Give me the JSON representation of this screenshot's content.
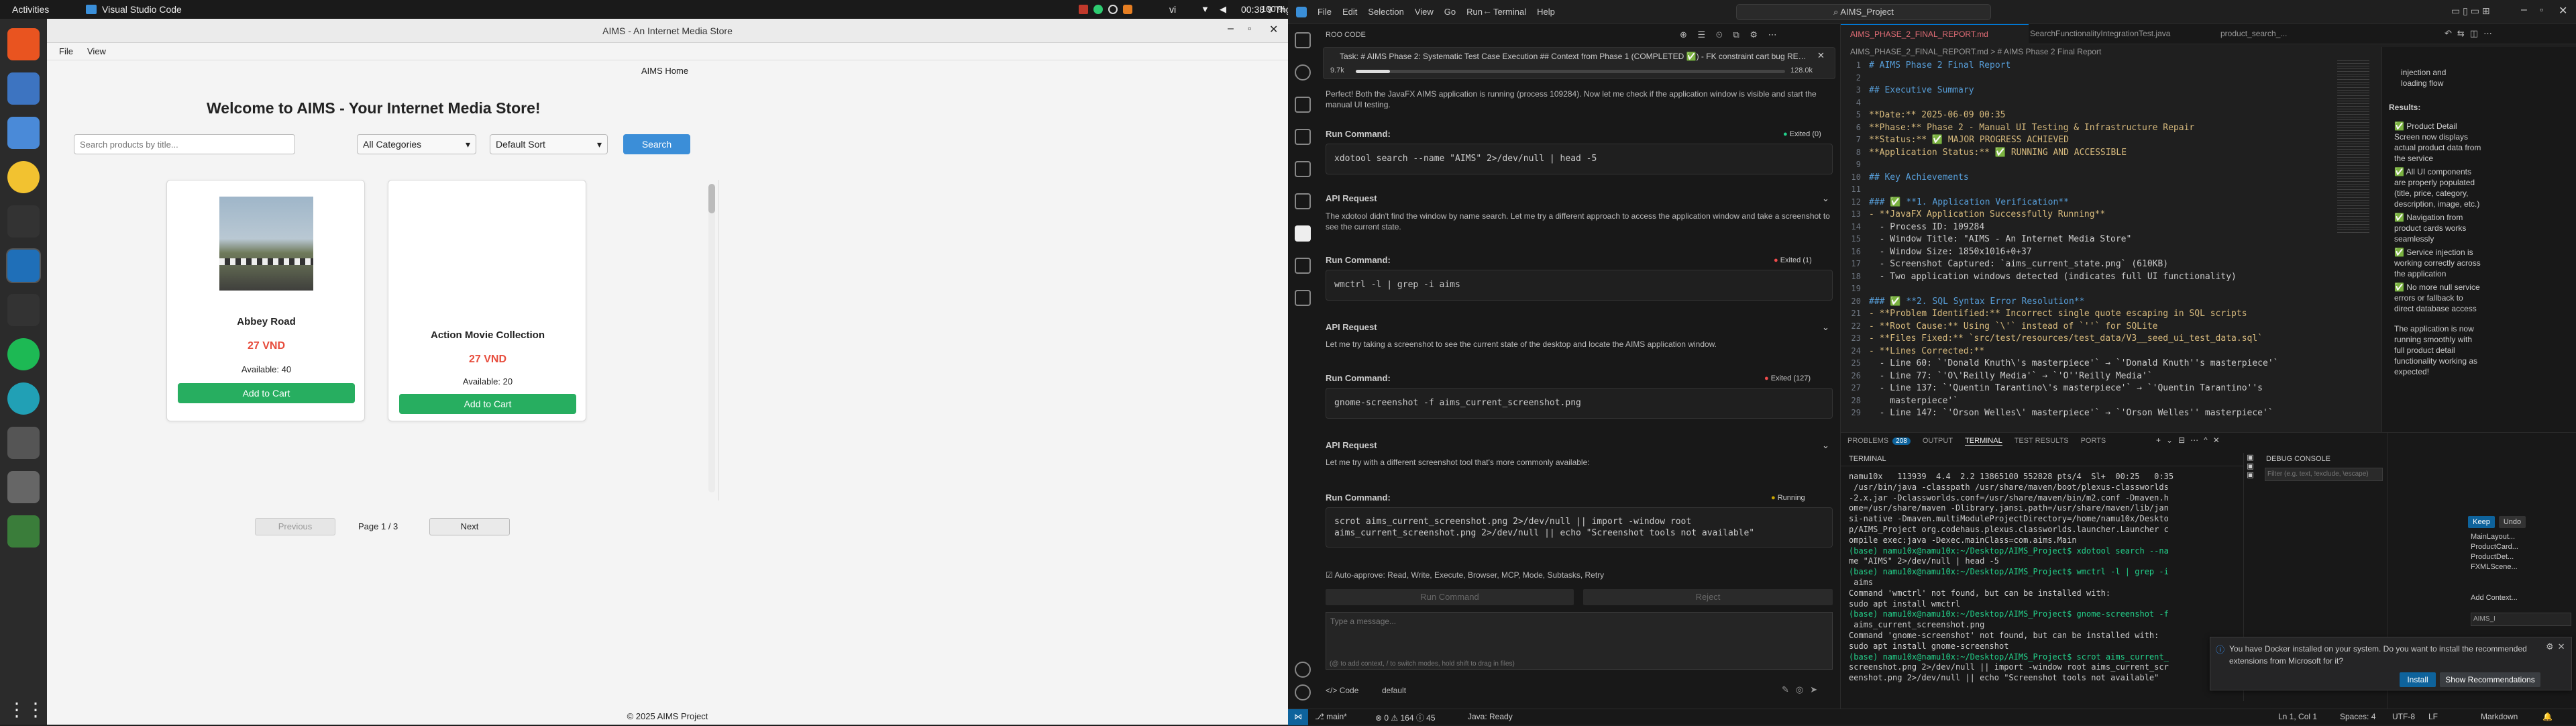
{
  "topbar": {
    "activities": "Activities",
    "app": "Visual Studio Code",
    "clock": "00:38 9 Thg 6",
    "lang": "vi",
    "battery": "100 %"
  },
  "fx": {
    "title": "AIMS - An Internet Media Store",
    "menu": {
      "file": "File",
      "view": "View"
    },
    "breadcrumb": "AIMS Home",
    "welcome": "Welcome to AIMS - Your Internet Media Store!",
    "search_placeholder": "Search products by title...",
    "category": "All Categories",
    "sort": "Default Sort",
    "search_btn": "Search",
    "products": [
      {
        "title": "Abbey Road",
        "price": "27 VND",
        "stock": "Available: 40",
        "btn": "Add to Cart"
      },
      {
        "title": "Action Movie Collection",
        "price": "27 VND",
        "stock": "Available: 20",
        "btn": "Add to Cart"
      }
    ],
    "pager": {
      "prev": "Previous",
      "page": "Page 1 / 3",
      "next": "Next"
    },
    "footer": "© 2025 AIMS Project"
  },
  "vs": {
    "menu": [
      "File",
      "Edit",
      "Selection",
      "View",
      "Go",
      "Run",
      "Terminal",
      "Help"
    ],
    "search": "AIMS_Project",
    "roo": {
      "header": "ROO CODE",
      "task": "Task: # AIMS Phase 2: Systematic Test Case Execution ## Context from Phase 1 (COMPLETED ✅) - FK constraint cart bug RESOL...",
      "tokens": "9.7k",
      "ctx": "128.0k",
      "intro": "Perfect! Both the JavaFX AIMS application is running (process 109284). Now let me check if the application window is visible and start the manual UI testing.",
      "blocks": [
        {
          "label": "Run Command:",
          "status": "Exited (0)",
          "cmd": "xdotool search --name \"AIMS\" 2>/dev/null | head -5"
        },
        {
          "label": "API Request",
          "text": "The xdotool didn't find the window by name search. Let me try a different approach to access the application window and take a screenshot to see the current state."
        },
        {
          "label": "Run Command:",
          "status": "Exited (1)",
          "cmd": "wmctrl -l | grep -i aims"
        },
        {
          "label": "API Request",
          "text": "Let me try taking a screenshot to see the current state of the desktop and locate the AIMS application window."
        },
        {
          "label": "Run Command:",
          "status": "Exited (127)",
          "cmd": "gnome-screenshot -f aims_current_screenshot.png"
        },
        {
          "label": "API Request",
          "text": "Let me try with a different screenshot tool that's more commonly available:"
        },
        {
          "label": "Run Command:",
          "status": "Running",
          "cmd": "scrot aims_current_screenshot.png 2>/dev/null || import -window root aims_current_screenshot.png 2>/dev/null || echo \"Screenshot tools not available\""
        }
      ],
      "auto": "Auto-approve: Read, Write, Execute, Browser, MCP, Mode, Subtasks, Retry",
      "runcmd": "Run Command",
      "reject": "Reject",
      "placeholder": "Type a message...",
      "hint": "(@ to add context, / to switch modes, hold shift to drag in files)",
      "mode": "Code",
      "profile": "default"
    },
    "tabs": [
      "AIMS_PHASE_2_FINAL_REPORT.md",
      "SearchFunctionalityIntegrationTest.java",
      "product_search_..."
    ],
    "breadcrumb": "AIMS_PHASE_2_FINAL_REPORT.md > # AIMS Phase 2 Final Report",
    "md": [
      "# AIMS Phase 2 Final Report",
      "",
      "## Executive Summary",
      "",
      "**Date:** 2025-06-09 00:35",
      "**Phase:** Phase 2 - Manual UI Testing & Infrastructure Repair",
      "**Status:** ✅ MAJOR PROGRESS ACHIEVED",
      "**Application Status:** ✅ RUNNING AND ACCESSIBLE",
      "",
      "## Key Achievements",
      "",
      "### ✅ **1. Application Verification**",
      "- **JavaFX Application Successfully Running**",
      "  - Process ID: 109284",
      "  - Window Title: \"AIMS - An Internet Media Store\"",
      "  - Window Size: 1850x1016+0+37",
      "  - Screenshot Captured: `aims_current_state.png` (610KB)",
      "  - Two application windows detected (indicates full UI functionality)",
      "",
      "### ✅ **2. SQL Syntax Error Resolution**",
      "- **Problem Identified:** Incorrect single quote escaping in SQL scripts",
      "- **Root Cause:** Using `\\'` instead of `''` for SQLite",
      "- **Files Fixed:** `src/test/resources/test_data/V3__seed_ui_test_data.sql`",
      "- **Lines Corrected:**",
      "  - Line 60: `'Donald Knuth\\'s masterpiece'` → `'Donald Knuth''s masterpiece'`",
      "  - Line 77: `'O\\'Reilly Media'` → `'O''Reilly Media'`",
      "  - Line 137: `'Quentin Tarantino\\'s masterpiece'` → `'Quentin Tarantino''s",
      "    masterpiece'`",
      "  - Line 147: `'Orson Welles\\' masterpiece'` → `'Orson Welles'' masterpiece'`"
    ],
    "panel_tabs": [
      "PROBLEMS",
      "OUTPUT",
      "TERMINAL",
      "TEST RESULTS",
      "PORTS"
    ],
    "problems_count": "208",
    "terminal": [
      "namu10x   113939  4.4  2.2 13865100 552828 pts/4  Sl+  00:25   0:35",
      " /usr/bin/java -classpath /usr/share/maven/boot/plexus-classworlds",
      "-2.x.jar -Dclassworlds.conf=/usr/share/maven/bin/m2.conf -Dmaven.h",
      "ome=/usr/share/maven -Dlibrary.jansi.path=/usr/share/maven/lib/jan",
      "si-native -Dmaven.multiModuleProjectDirectory=/home/namu10x/Deskto",
      "p/AIMS_Project org.codehaus.plexus.classworlds.launcher.Launcher c",
      "ompile exec:java -Dexec.mainClass=com.aims.Main",
      "(base) namu10x@namu10x:~/Desktop/AIMS_Project$ xdotool search --na",
      "me \"AIMS\" 2>/dev/null | head -5",
      "(base) namu10x@namu10x:~/Desktop/AIMS_Project$ wmctrl -l | grep -i",
      " aims",
      "Command 'wmctrl' not found, but can be installed with:",
      "sudo apt install wmctrl",
      "(base) namu10x@namu10x:~/Desktop/AIMS_Project$ gnome-screenshot -f",
      " aims_current_screenshot.png",
      "Command 'gnome-screenshot' not found, but can be installed with:",
      "sudo apt install gnome-screenshot",
      "(base) namu10x@namu10x:~/Desktop/AIMS_Project$ scrot aims_current_",
      "screenshot.png 2>/dev/null || import -window root aims_current_scr",
      "eenshot.png 2>/dev/null || echo \"Screenshot tools not available\""
    ],
    "terminal_header": "TERMINAL",
    "debug": "DEBUG CONSOLE",
    "filter": "Filter (e.g. text, !exclude, \\escape)",
    "right": {
      "top": [
        "injection and",
        "loading flow"
      ],
      "results": "Results:",
      "items": [
        "✅ Product Detail Screen now displays actual product data from the service",
        "✅ All UI components are properly populated (title, price, category, description, image, etc.)",
        "✅ Navigation from product cards works seamlessly",
        "✅ Service injection is working correctly across the application",
        "✅ No more null service errors or fallback to direct database access"
      ],
      "summary": "The application is now running smoothly with full product detail functionality working as expected!",
      "keep": "Keep",
      "undo": "Undo",
      "files": [
        "MainLayout...",
        "ProductCard...",
        "ProductDet...",
        "FXMLScene..."
      ],
      "addctx": "Add Context...",
      "chip": "AIMS_I"
    },
    "notif": {
      "text": "You have Docker installed on your system. Do you want to install the recommended extensions from Microsoft for it?",
      "install": "Install",
      "show": "Show Recommendations"
    },
    "status": {
      "branch": "main*",
      "errors": "⊗ 0 ⚠ 164 ⓘ 45",
      "java": "Java: Ready",
      "pos": "Ln 1, Col 1",
      "spaces": "Spaces: 4",
      "enc": "UTF-8",
      "eol": "LF",
      "lang": "Markdown"
    }
  }
}
